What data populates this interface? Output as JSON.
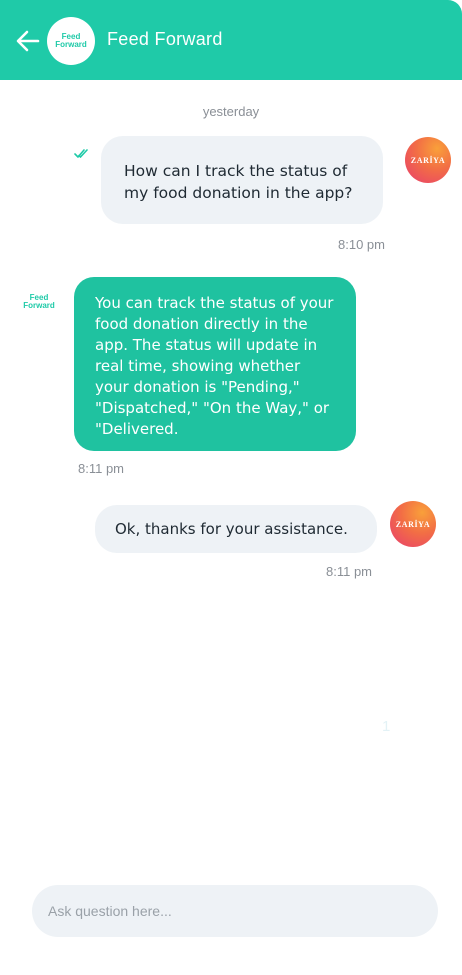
{
  "header": {
    "title": "Feed Forward",
    "logo_line1": "Feed",
    "logo_line2": "Forward",
    "back_icon": "arrow-left-icon",
    "background": "#1fcaa8"
  },
  "chat": {
    "date_separator": "yesterday",
    "messages": [
      {
        "sender": "user",
        "avatar_label": "ZARİYA",
        "text": "How can I track the status of my food donation in the app?",
        "time": "8:10 pm",
        "status_icon": "double-check-icon"
      },
      {
        "sender": "bot",
        "logo_line1": "Feed",
        "logo_line2": "Forward",
        "text": "You can track the status of your food donation directly in the app. The status will update in real time, showing whether your donation is \"Pending,\" \"Dispatched,\" \"On the Way,\" or \"Delivered.",
        "time": "8:11 pm"
      },
      {
        "sender": "user",
        "avatar_label": "ZARİYA",
        "text": "Ok, thanks for your assistance.",
        "time": "8:11 pm"
      }
    ],
    "faint_counter": "1"
  },
  "composer": {
    "placeholder": "Ask question here...",
    "value": ""
  },
  "colors": {
    "accent": "#1fcaa8",
    "bot_bubble": "#1fc2a0",
    "user_bubble": "#eef2f6",
    "muted_text": "#8a8f96"
  }
}
